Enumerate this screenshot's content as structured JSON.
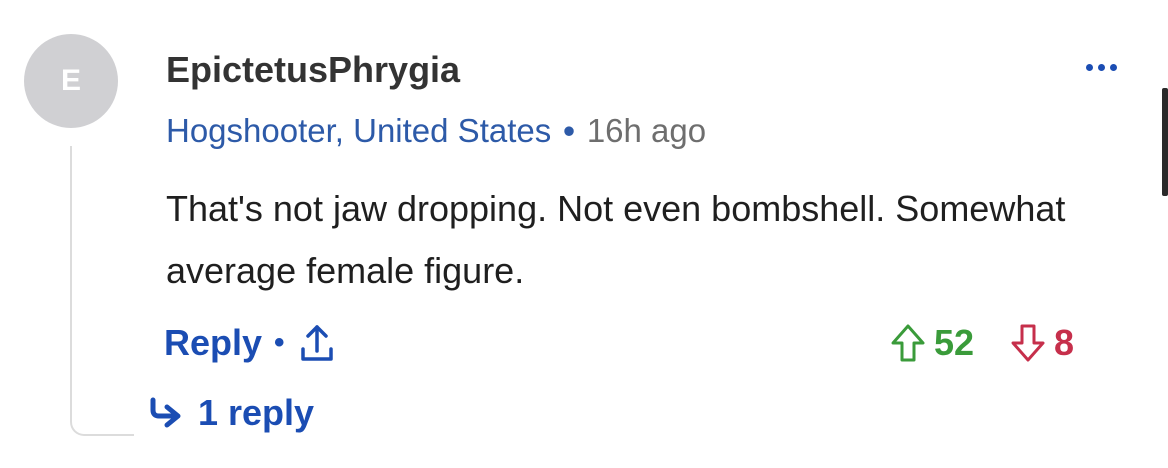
{
  "comment": {
    "avatar_initial": "E",
    "username": "EpictetusPhrygia",
    "location": "Hogshooter, United States",
    "separator": "•",
    "time": "16h ago",
    "text": "That's not jaw dropping. Not even bombshell. Somewhat average female figure.",
    "more_icon": "more-dots-icon"
  },
  "actions": {
    "reply_label": "Reply",
    "separator": "•",
    "share_icon": "share-icon"
  },
  "votes": {
    "up_count": "52",
    "down_count": "8",
    "up_icon": "arrow-up-icon",
    "down_icon": "arrow-down-icon"
  },
  "replies": {
    "label": "1 reply",
    "icon": "reply-arrow-icon"
  },
  "colors": {
    "link_blue": "#1b4db3",
    "upvote_green": "#3a9b3a",
    "downvote_red": "#c62f4b",
    "avatar_gray": "#d0d0d3"
  }
}
